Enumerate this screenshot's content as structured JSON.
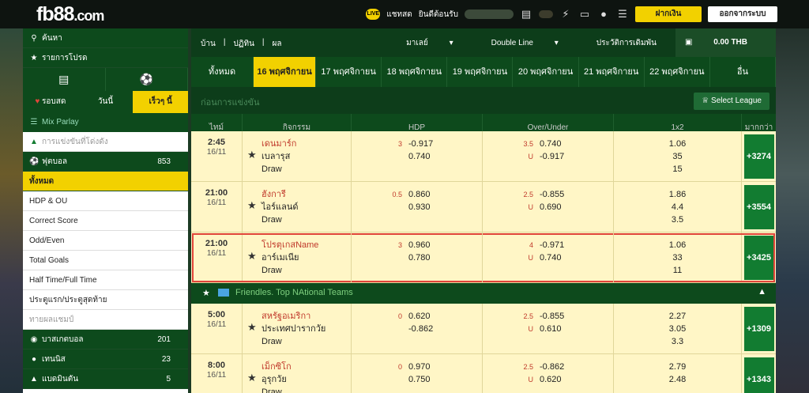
{
  "topbar": {
    "logo_main": "fb88",
    "logo_suffix": ".com",
    "chat_label": "แชทสด",
    "welcome": "ยินดีต้อนรับ",
    "chat_badge": "LIVE",
    "deposit": "ฝากเงิน",
    "logout": "ออกจากระบบ"
  },
  "sidebar": {
    "search": "ค้นหา",
    "favorites": "รายการโปรด",
    "tabs": [
      "รอบสด",
      "วันนี้",
      "เร็วๆ นี้"
    ],
    "mix_parlay": "Mix Parlay",
    "popular": "การแข่งขันที่โด่งดัง",
    "football": {
      "label": "ฟุตบอล",
      "count": "853"
    },
    "all": "ทั้งหมด",
    "markets": [
      "HDP & OU",
      "Correct Score",
      "Odd/Even",
      "Total Goals",
      "Half Time/Full Time",
      "ประตูแรก/ประตูสุดท้าย"
    ],
    "results": "ทายผลแชมป์",
    "sports": [
      {
        "label": "บาสเกตบอล",
        "count": "201"
      },
      {
        "label": "เทนนิส",
        "count": "23"
      },
      {
        "label": "แบดมินตัน",
        "count": "5"
      }
    ]
  },
  "main": {
    "breadcrumb": [
      "บ้าน",
      "ปฏิทิน",
      "ผล"
    ],
    "market_filter": "มาเลย์",
    "line_mode": "Double Line",
    "bet_history": "ประวัติการเดิมพัน",
    "balance": "0.00 THB",
    "dates": [
      "ทั้งหมด",
      "16 พฤศจิกายน",
      "17 พฤศจิกายน",
      "18 พฤศจิกายน",
      "19 พฤศจิกายน",
      "20 พฤศจิกายน",
      "21 พฤศจิกายน",
      "22 พฤศจิกายน",
      "อื่น"
    ],
    "section_title": "ก่อนการแข่งขัน",
    "select_league": "Select League",
    "columns": [
      "ไทม์",
      "กิจกรรม",
      "HDP",
      "Over/Under",
      "1x2",
      "มากกว่า"
    ],
    "matches_a": [
      {
        "time": "2:45",
        "date": "16/11",
        "home": "เดนมาร์ก",
        "away": "เบลารุส",
        "draw": "Draw",
        "hdp_line": "3",
        "hdp": [
          "-0.917",
          "0.740"
        ],
        "ou_line": "3.5",
        "ou_u": "U",
        "ou": [
          "0.740",
          "-0.917"
        ],
        "x12": [
          "1.06",
          "35",
          "15"
        ],
        "more": "+3274"
      },
      {
        "time": "21:00",
        "date": "16/11",
        "home": "ฮังการี",
        "away": "ไอร์แลนด์",
        "draw": "Draw",
        "hdp_line": "0.5",
        "hdp": [
          "0.860",
          "0.930"
        ],
        "ou_line": "2.5",
        "ou_u": "U",
        "ou": [
          "-0.855",
          "0.690"
        ],
        "x12": [
          "1.86",
          "4.4",
          "3.5"
        ],
        "more": "+3554"
      },
      {
        "time": "21:00",
        "date": "16/11",
        "home": "โปรตุเกสName",
        "away": "อาร์เมเนีย",
        "draw": "Draw",
        "hdp_line": "3",
        "hdp": [
          "0.960",
          "0.780"
        ],
        "ou_line": "4",
        "ou_u": "U",
        "ou": [
          "-0.971",
          "0.740"
        ],
        "x12": [
          "1.06",
          "33",
          "11"
        ],
        "more": "+3425"
      }
    ],
    "league_b": "Friendles. Top NAtional Teams",
    "matches_b": [
      {
        "time": "5:00",
        "date": "16/11",
        "home": "สหรัฐอเมริกา",
        "away": "ประเทศปารากวัย",
        "draw": "Draw",
        "hdp_line": "0",
        "hdp": [
          "0.620",
          "-0.862"
        ],
        "ou_line": "2.5",
        "ou_u": "U",
        "ou": [
          "-0.855",
          "0.610"
        ],
        "x12": [
          "2.27",
          "3.05",
          "3.3"
        ],
        "more": "+1309"
      },
      {
        "time": "8:00",
        "date": "16/11",
        "home": "เม็กซิโก",
        "away": "อุรุกวัย",
        "draw": "Draw",
        "hdp_line": "0",
        "hdp": [
          "0.970",
          "0.750"
        ],
        "ou_line": "2.5",
        "ou_u": "U",
        "ou": [
          "-0.862",
          "0.620"
        ],
        "x12": [
          "2.79",
          "2.48",
          ""
        ],
        "more": "+1343"
      }
    ]
  }
}
